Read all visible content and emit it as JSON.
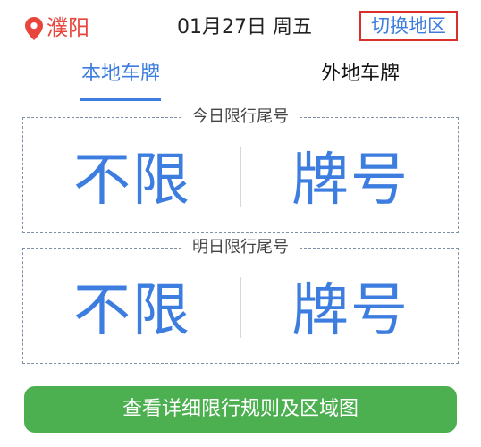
{
  "header": {
    "location_icon": "location-pin-icon",
    "city": "濮阳",
    "date": "01月27日 周五",
    "switch_label": "切换地区"
  },
  "tabs": [
    {
      "label": "本地车牌",
      "active": true
    },
    {
      "label": "外地车牌",
      "active": false
    }
  ],
  "today": {
    "title": "今日限行尾号",
    "left": "不限",
    "right": "牌号"
  },
  "tomorrow": {
    "title": "明日限行尾号",
    "left": "不限",
    "right": "牌号"
  },
  "detail_button": {
    "label": "查看详细限行规则及区域图"
  },
  "colors": {
    "accent": "#3d7de0",
    "city": "#e8453c",
    "switch_border": "#d9302c",
    "button_green": "#4caf50"
  }
}
